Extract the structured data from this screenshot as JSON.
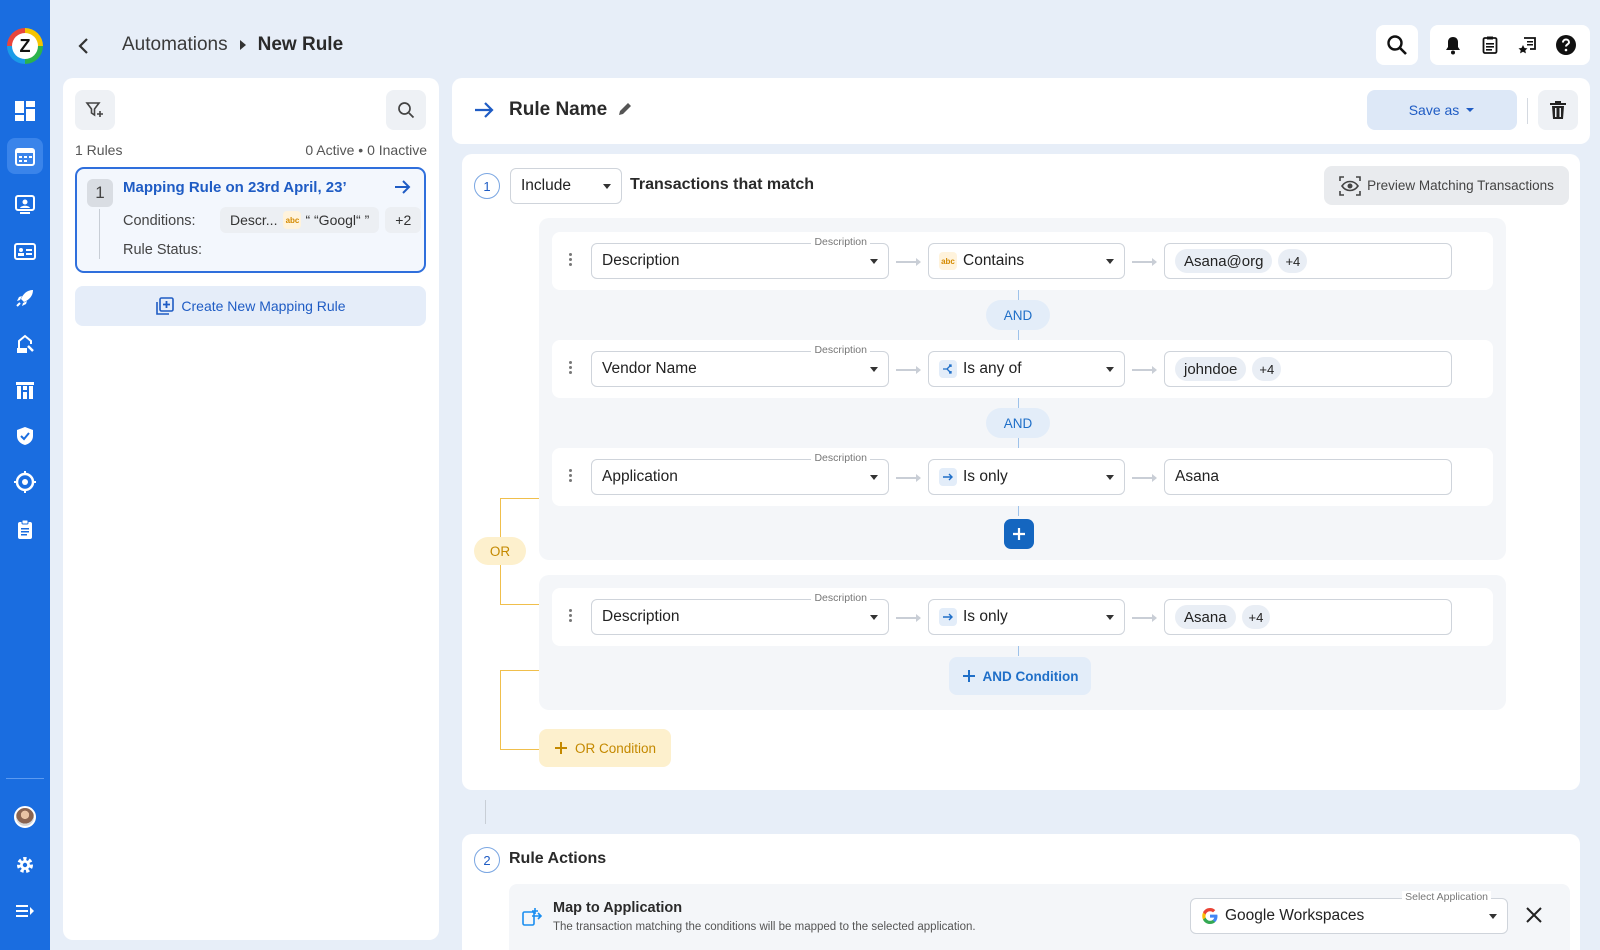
{
  "breadcrumb": {
    "parent": "Automations",
    "current": "New Rule"
  },
  "rules_panel": {
    "count_label": "1 Rules",
    "status_summary": "0 Active • 0 Inactive",
    "rule": {
      "number": "1",
      "title": "Mapping Rule on 23rd April, 23’",
      "conditions_label": "Conditions:",
      "condition_field": "Descr...",
      "condition_value": "“ “Googl“ ”",
      "condition_more": "+2",
      "status_label": "Rule Status:"
    },
    "create_button": "Create New Mapping Rule"
  },
  "editor": {
    "rule_name": "Rule Name",
    "save_as": "Save as",
    "step1": {
      "number": "1",
      "include": "Include",
      "title": "Transactions that match",
      "preview": "Preview Matching Transactions"
    },
    "field_label": "Description",
    "and_label": "AND",
    "or_label": "OR",
    "conditions": [
      {
        "field": "Description",
        "operator": "Contains",
        "values": [
          "Asana@org"
        ],
        "more": "+4"
      },
      {
        "field": "Vendor Name",
        "operator": "Is any of",
        "values": [
          "johndoe"
        ],
        "more": "+4"
      },
      {
        "field": "Application",
        "operator": "Is only",
        "values": [
          "Asana"
        ],
        "more": ""
      },
      {
        "field": "Description",
        "operator": "Is only",
        "values": [
          "Asana"
        ],
        "more": "+4"
      }
    ],
    "and_condition": "AND Condition",
    "or_condition": "OR Condition",
    "step2": {
      "number": "2",
      "title": "Rule Actions",
      "action_title": "Map to Application",
      "action_desc": "The transaction matching the conditions will be mapped to the selected application.",
      "select_label": "Select Application",
      "selected_app": "Google Workspaces"
    }
  },
  "colors": {
    "accent": "#1a6de0",
    "or": "#f0bf4c",
    "and": "#1f6fc8"
  }
}
